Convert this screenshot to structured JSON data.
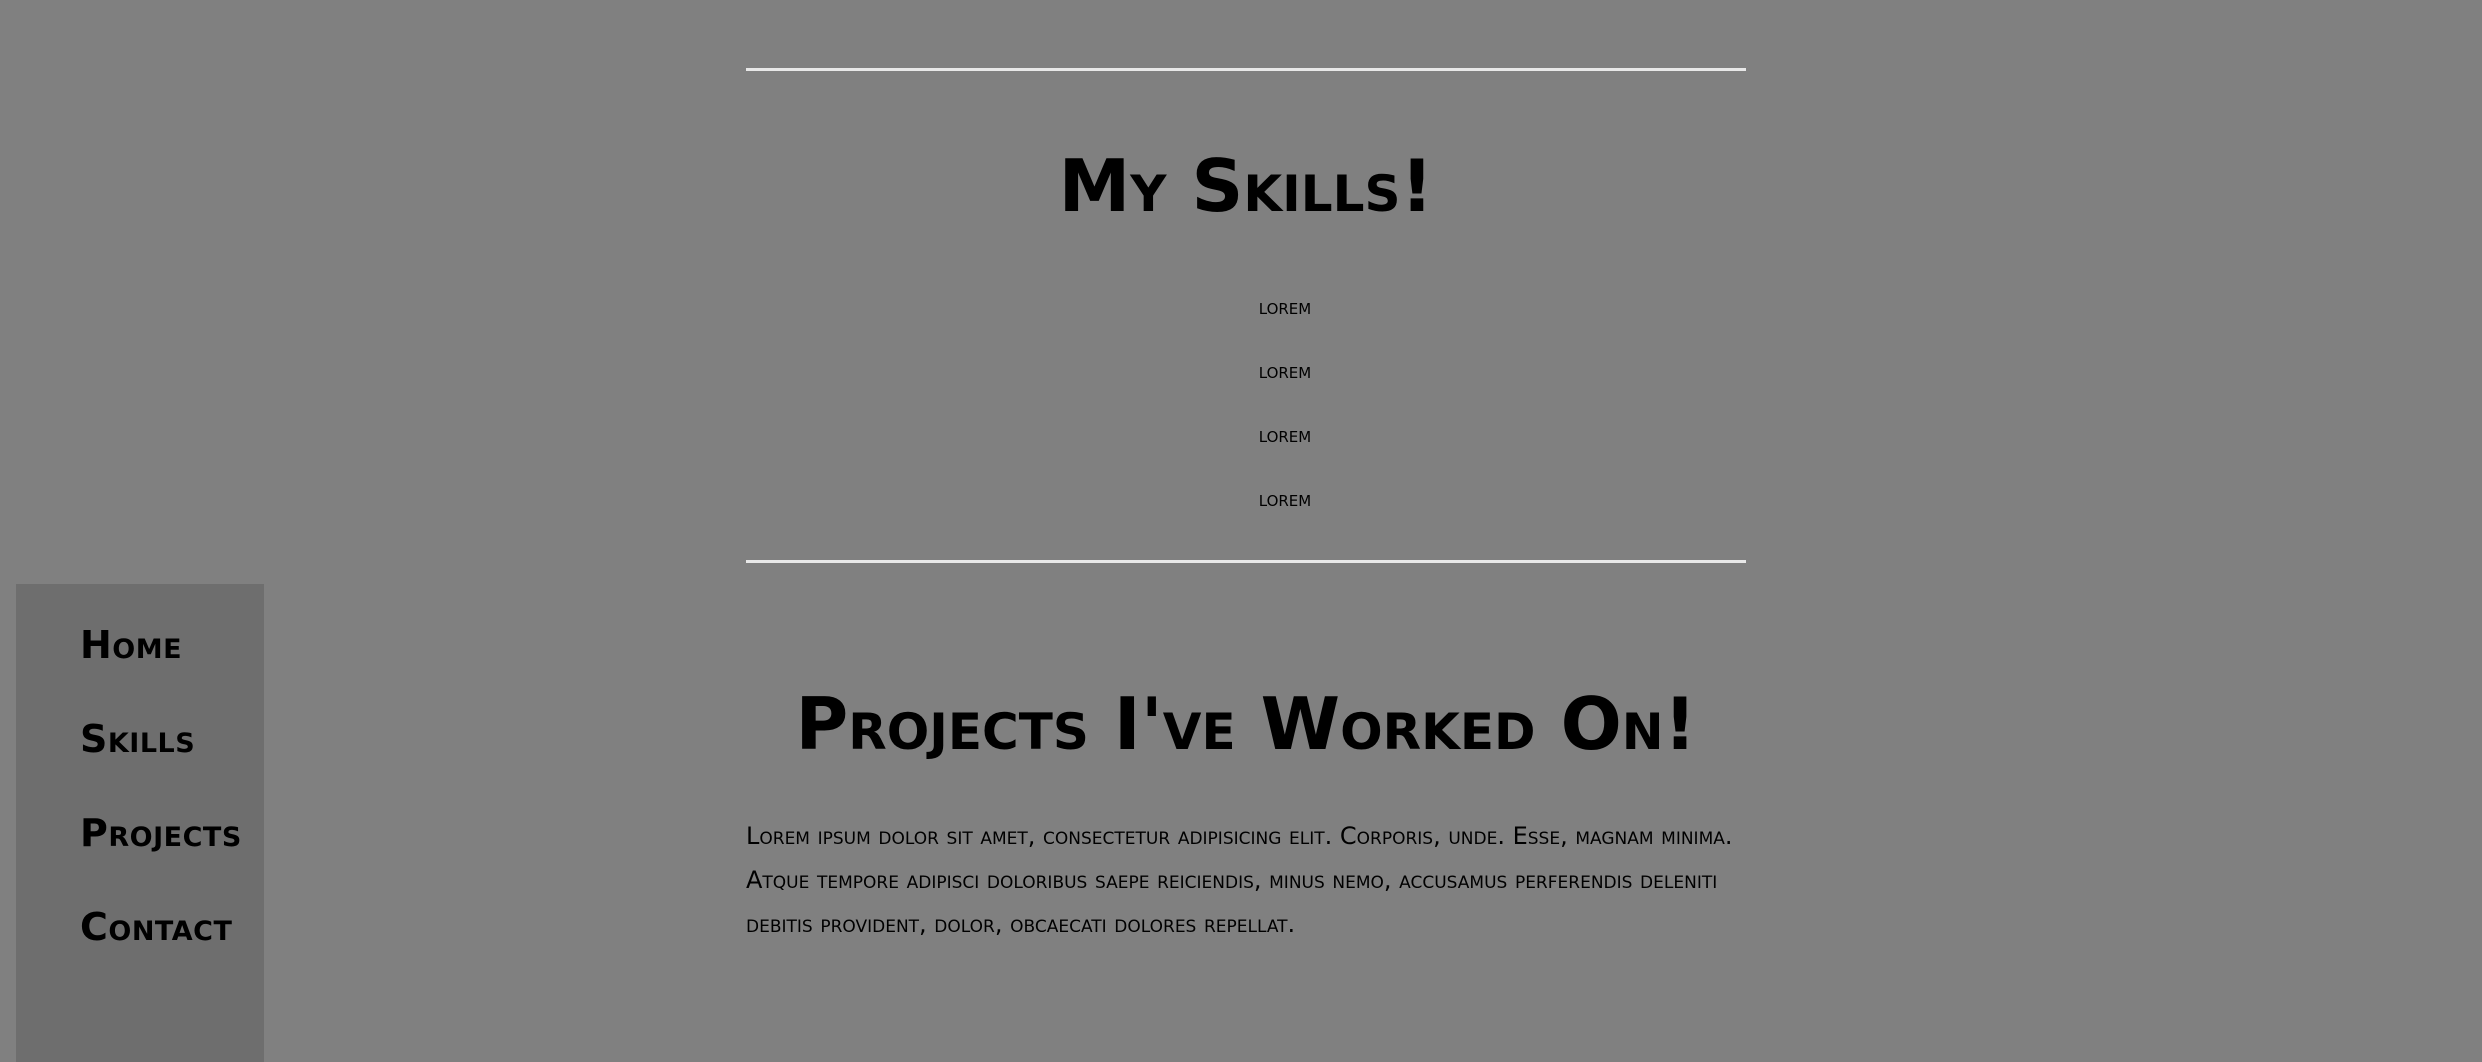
{
  "nav": {
    "items": [
      {
        "label": "Home"
      },
      {
        "label": "Skills"
      },
      {
        "label": "Projects"
      },
      {
        "label": "Contact"
      }
    ]
  },
  "skills": {
    "title": "My Skills!",
    "items": [
      "lorem",
      "lorem",
      "lorem",
      "lorem"
    ]
  },
  "projects": {
    "title": "Projects I've Worked On!",
    "description": "Lorem ipsum dolor sit amet, consectetur adipisicing elit. Corporis, unde. Esse, magnam minima. Atque tempore adipisci doloribus saepe reiciendis, minus nemo, accusamus perferendis deleniti debitis provident, dolor, obcaecati dolores repellat."
  },
  "colors": {
    "page_background": "#808080",
    "sidebar_background": "#6e6e6e",
    "rule": "#e8e8e8",
    "text": "#000000"
  }
}
